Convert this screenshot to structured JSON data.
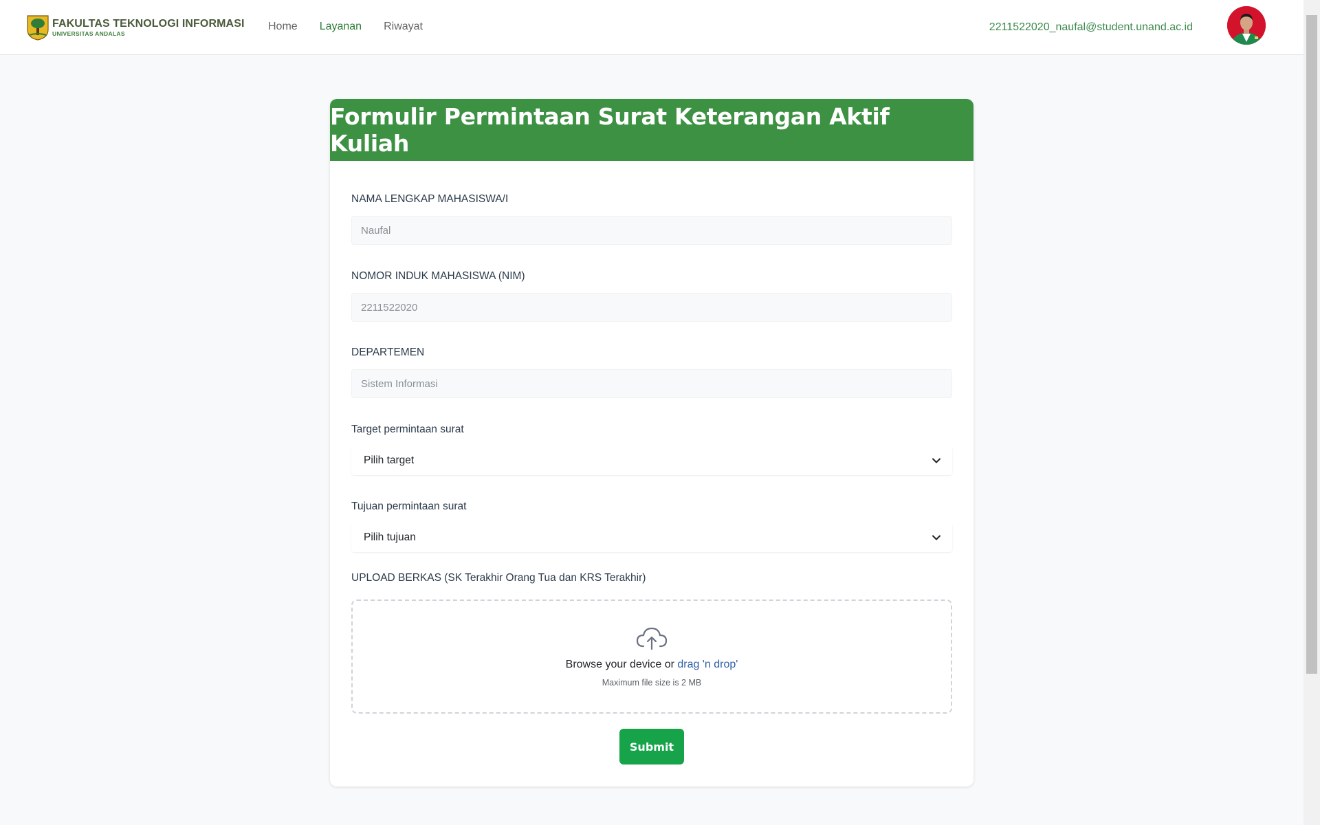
{
  "header": {
    "brand_title": "FAKULTAS TEKNOLOGI INFORMASI",
    "brand_subtitle": "UNIVERSITAS ANDALAS",
    "nav": [
      {
        "label": "Home",
        "active": false
      },
      {
        "label": "Layanan",
        "active": true
      },
      {
        "label": "Riwayat",
        "active": false
      }
    ],
    "user_email": "2211522020_naufal@student.unand.ac.id"
  },
  "form": {
    "title": "Formulir Permintaan Surat Keterangan Aktif Kuliah",
    "fields": {
      "nama": {
        "label": "NAMA LENGKAP MAHASISWA/I",
        "value": "Naufal"
      },
      "nim": {
        "label": "NOMOR INDUK MAHASISWA (NIM)",
        "value": "2211522020"
      },
      "departemen": {
        "label": "DEPARTEMEN",
        "value": "Sistem Informasi"
      },
      "target": {
        "label": "Target permintaan surat",
        "selected": "Pilih target"
      },
      "tujuan": {
        "label": "Tujuan permintaan surat",
        "selected": "Pilih tujuan"
      }
    },
    "upload": {
      "label": "UPLOAD BERKAS (SK Terakhir Orang Tua dan KRS Terakhir)",
      "text_prefix": "Browse your device or ",
      "text_link": "drag 'n drop'",
      "hint": "Maximum file size is 2 MB"
    },
    "submit_label": "Submit"
  },
  "colors": {
    "primary_green": "#3d9143",
    "submit_green": "#16a34a",
    "nav_active": "#2f7d3a",
    "link_blue": "#2f5fa7"
  },
  "icons": {
    "brand": "university-logo",
    "avatar": "user-avatar",
    "select": "chevron-down-icon",
    "upload": "cloud-upload-icon"
  }
}
